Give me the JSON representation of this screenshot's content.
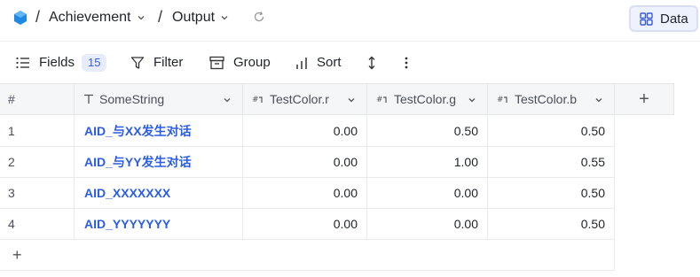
{
  "breadcrumb": {
    "separator": "/",
    "project": "Achievement",
    "sheet": "Output"
  },
  "view_button": {
    "label": "Data"
  },
  "toolbar": {
    "fields_label": "Fields",
    "fields_count": "15",
    "filter_label": "Filter",
    "group_label": "Group",
    "sort_label": "Sort"
  },
  "table": {
    "index_header": "#",
    "columns": [
      {
        "name": "SomeString",
        "icon": "text-type-icon"
      },
      {
        "name": "TestColor.r",
        "icon": "number-type-icon"
      },
      {
        "name": "TestColor.g",
        "icon": "number-type-icon"
      },
      {
        "name": "TestColor.b",
        "icon": "number-type-icon"
      }
    ],
    "add_column_label": "+",
    "add_row_label": "+",
    "rows": [
      {
        "index": "1",
        "cells": [
          "AID_与XX发生对话",
          "0.00",
          "0.50",
          "0.50"
        ]
      },
      {
        "index": "2",
        "cells": [
          "AID_与YY发生对话",
          "0.00",
          "1.00",
          "0.55"
        ]
      },
      {
        "index": "3",
        "cells": [
          "AID_XXXXXXX",
          "0.00",
          "0.00",
          "0.50"
        ]
      },
      {
        "index": "4",
        "cells": [
          "AID_YYYYYYY",
          "0.00",
          "0.00",
          "0.50"
        ]
      }
    ]
  },
  "colors": {
    "accent": "#2b5ce6",
    "header_bg": "#f5f6f8",
    "badge_bg": "#e6ecfb"
  }
}
